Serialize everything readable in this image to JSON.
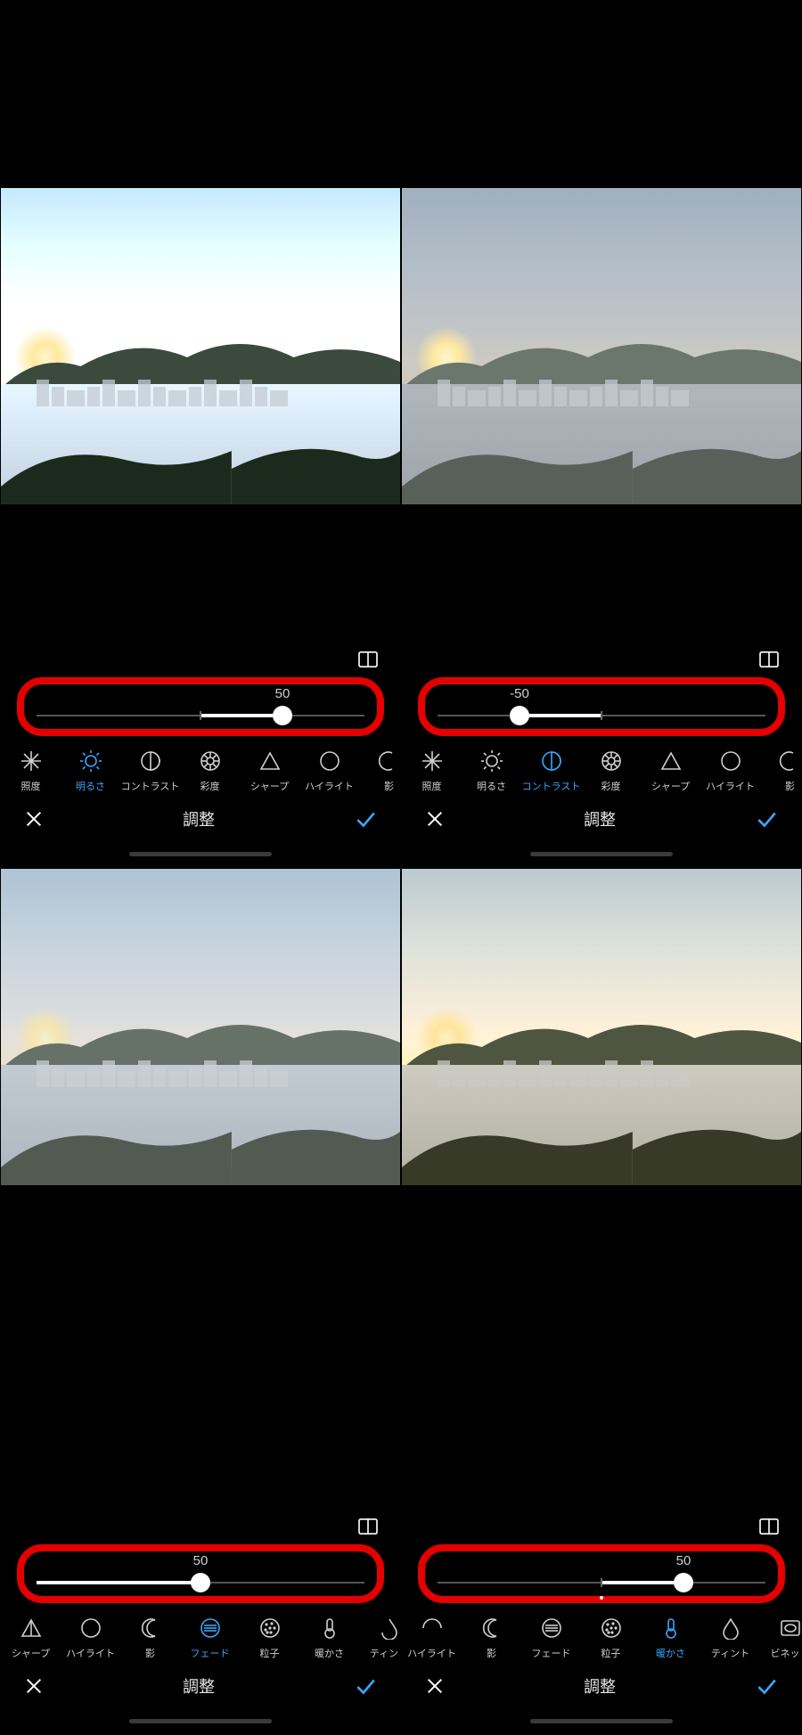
{
  "accent_color": "#3aa7ff",
  "highlight_color": "#e40000",
  "panels": [
    {
      "id": "p0",
      "slider_value": "50",
      "slider_pos_pct": 75,
      "slider_mode": "bipolar",
      "title": "調整",
      "params": [
        {
          "label": "照度",
          "icon": "sparkle"
        },
        {
          "label": "明るさ",
          "icon": "sun",
          "active": true
        },
        {
          "label": "コントラスト",
          "icon": "half"
        },
        {
          "label": "彩度",
          "icon": "burst"
        },
        {
          "label": "シャープ",
          "icon": "tri"
        },
        {
          "label": "ハイライト",
          "icon": "circle"
        },
        {
          "label": "影",
          "icon": "moon-cut"
        }
      ]
    },
    {
      "id": "p1",
      "slider_value": "-50",
      "slider_pos_pct": 25,
      "slider_mode": "bipolar",
      "title": "調整",
      "params": [
        {
          "label": "照度",
          "icon": "sparkle"
        },
        {
          "label": "明るさ",
          "icon": "sun"
        },
        {
          "label": "コントラスト",
          "icon": "half",
          "active": true
        },
        {
          "label": "彩度",
          "icon": "burst"
        },
        {
          "label": "シャープ",
          "icon": "tri"
        },
        {
          "label": "ハイライト",
          "icon": "circle"
        },
        {
          "label": "影",
          "icon": "moon-cut"
        }
      ]
    },
    {
      "id": "p2",
      "slider_value": "50",
      "slider_pos_pct": 50,
      "slider_mode": "unipolar",
      "title": "調整",
      "params": [
        {
          "label": "シャープ",
          "icon": "tri-cut"
        },
        {
          "label": "ハイライト",
          "icon": "circle"
        },
        {
          "label": "影",
          "icon": "moon"
        },
        {
          "label": "フェード",
          "icon": "lines",
          "active": true
        },
        {
          "label": "粒子",
          "icon": "dots"
        },
        {
          "label": "暖かさ",
          "icon": "thermo"
        },
        {
          "label": "ティント",
          "icon": "drop-cut"
        }
      ]
    },
    {
      "id": "p3",
      "slider_value": "50",
      "slider_pos_pct": 75,
      "slider_mode": "bipolar",
      "show_dot_below": true,
      "title": "調整",
      "params": [
        {
          "label": "ハイライト",
          "icon": "circle-cut"
        },
        {
          "label": "影",
          "icon": "moon"
        },
        {
          "label": "フェード",
          "icon": "lines"
        },
        {
          "label": "粒子",
          "icon": "dots"
        },
        {
          "label": "暖かさ",
          "icon": "thermo",
          "active": true
        },
        {
          "label": "ティント",
          "icon": "drop"
        },
        {
          "label": "ビネット",
          "icon": "vignette"
        }
      ]
    }
  ]
}
